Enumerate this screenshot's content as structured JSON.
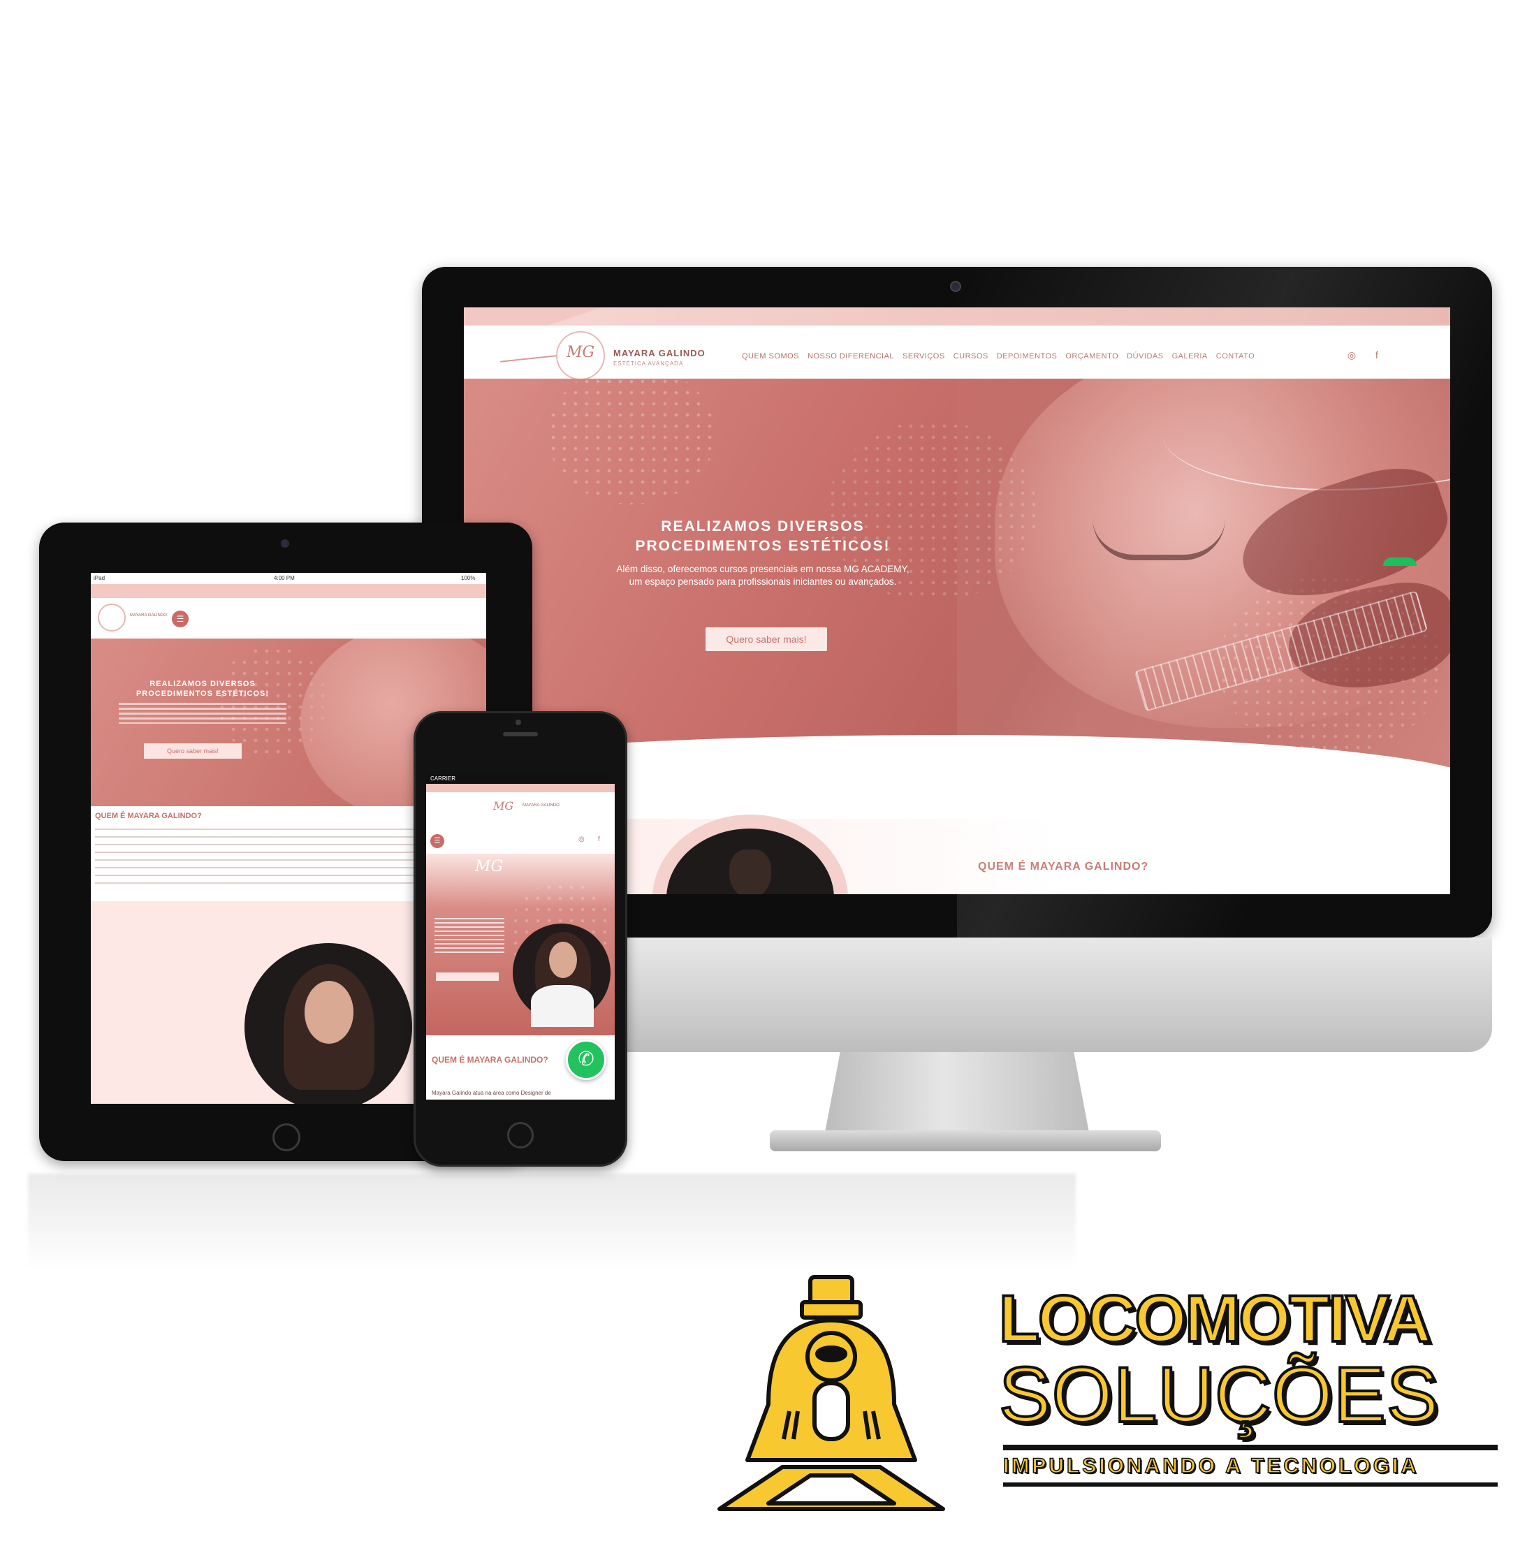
{
  "desktop": {
    "brand": "MAYARA GALINDO",
    "brand_sub": "ESTÉTICA AVANÇADA",
    "logo_mark": "MG",
    "nav": [
      "QUEM SOMOS",
      "NOSSO DIFERENCIAL",
      "SERVIÇOS",
      "CURSOS",
      "DEPOIMENTOS",
      "ORÇAMENTO",
      "DÚVIDAS",
      "GALERIA",
      "CONTATO"
    ],
    "social": [
      "instagram-icon",
      "facebook-icon"
    ],
    "hero_title": "REALIZAMOS DIVERSOS PROCEDIMENTOS ESTÉTICOS!",
    "hero_text": "Além disso, oferecemos cursos presenciais em nossa MG ACADEMY, um espaço pensado para profissionais iniciantes ou avançados.",
    "hero_button": "Quero saber mais!",
    "section_title": "QUEM É MAYARA GALINDO?"
  },
  "tablet": {
    "status_left": "iPad",
    "status_center": "4:00 PM",
    "status_right": "100%",
    "hero_title": "REALIZAMOS DIVERSOS PROCEDIMENTOS ESTÉTICOS!",
    "hero_button": "Quero saber mais!",
    "section_title": "QUEM É MAYARA GALINDO?",
    "menu_icon": "☰"
  },
  "phone": {
    "status": "CARRIER",
    "logo_mark": "MG",
    "brand": "MAYARA GALINDO",
    "section_title": "QUEM É MAYARA GALINDO?",
    "paragraph_start": "Mayara Galindo atua na área como Designer de",
    "menu_icon": "☰",
    "whatsapp_icon": "✆"
  },
  "logo": {
    "line1": "LOCOMOTIVA",
    "line2": "SOLUÇÕES",
    "tagline": "IMPULSIONANDO A TECNOLOGIA",
    "colors": {
      "yellow": "#f8c830",
      "outline": "#111111"
    }
  },
  "colors": {
    "accent_pink": "#c9706b",
    "light_pink": "#fbe4e1",
    "whatsapp_green": "#22c35e"
  }
}
